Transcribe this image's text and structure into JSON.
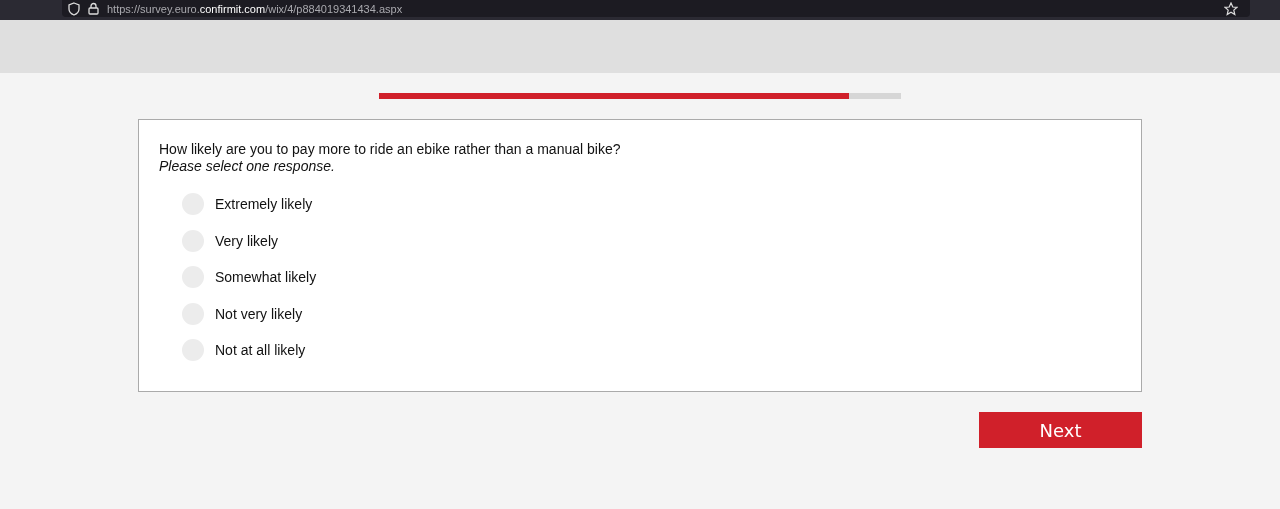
{
  "browser": {
    "url": "https://survey.euro.**confirmit.com**/wix/4/p884019341434.aspx"
  },
  "progress": {
    "level": 0.9
  },
  "question": {
    "text": "How likely are you to pay more to ride an ebike rather than a manual bike?",
    "instruction": "Please select one response.",
    "options": [
      {
        "label": "Extremely likely",
        "selected": false
      },
      {
        "label": "Very likely",
        "selected": false
      },
      {
        "label": "Somewhat likely",
        "selected": false
      },
      {
        "label": "Not very likely",
        "selected": false
      },
      {
        "label": "Not at all likely",
        "selected": false
      }
    ]
  },
  "next_button": "Next"
}
